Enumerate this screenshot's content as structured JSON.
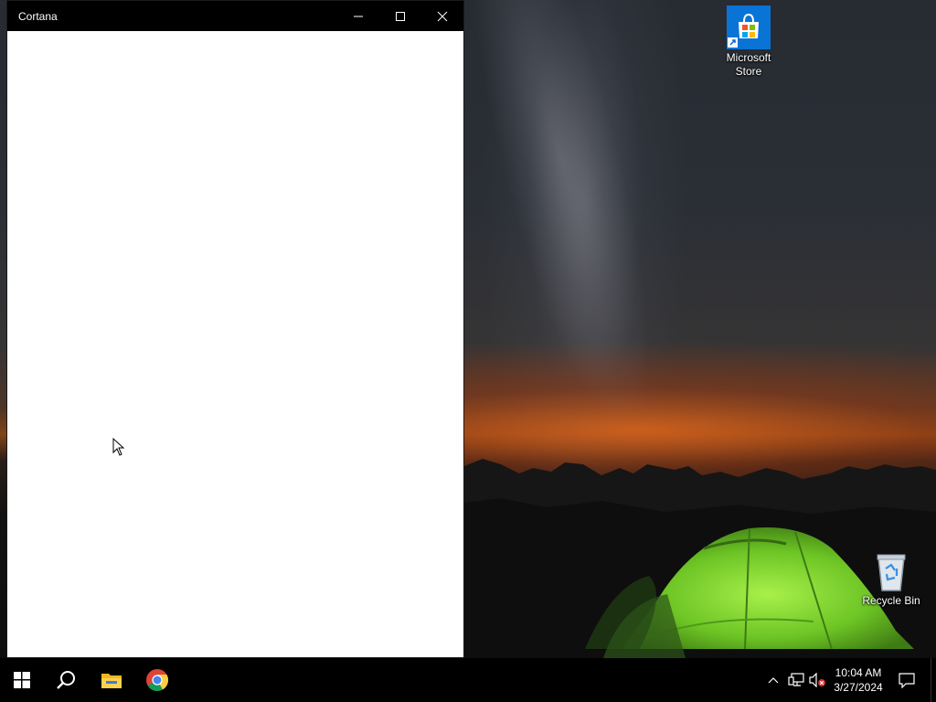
{
  "desktop": {
    "icons": [
      {
        "label": "Microsoft\nStore",
        "icon": "microsoft-store-icon"
      },
      {
        "label": "Recycle Bin",
        "icon": "recycle-bin-icon"
      }
    ]
  },
  "window": {
    "title": "Cortana",
    "controls": [
      "minimize-icon",
      "maximize-icon",
      "close-icon"
    ]
  },
  "taskbar": {
    "pinned": [
      "windows-start-icon",
      "search-icon",
      "file-explorer-icon",
      "chrome-icon"
    ],
    "tray": [
      "chevron-up-icon",
      "network-icon",
      "volume-muted-icon",
      "notification-icon"
    ],
    "clock": {
      "time": "10:04 AM",
      "date": "3/27/2024"
    }
  },
  "colors": {
    "titlebar": "#000000",
    "taskbar": "#000000",
    "window_body": "#ffffff",
    "tent_green": "#7fd12f"
  }
}
